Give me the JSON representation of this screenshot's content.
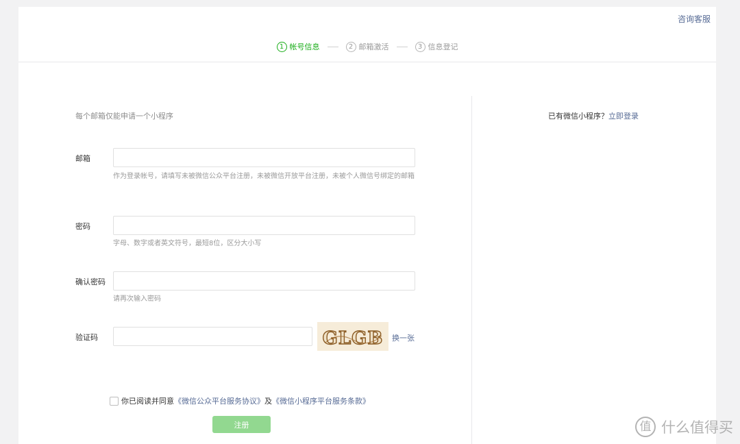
{
  "header": {
    "help_link": "咨询客服",
    "steps": [
      {
        "num": "1",
        "label": "帐号信息"
      },
      {
        "num": "2",
        "label": "邮箱激活"
      },
      {
        "num": "3",
        "label": "信息登记"
      }
    ]
  },
  "form": {
    "tip": "每个邮箱仅能申请一个小程序",
    "email": {
      "label": "邮箱",
      "value": "",
      "hint": "作为登录帐号，请填写未被微信公众平台注册，未被微信开放平台注册，未被个人微信号绑定的邮箱"
    },
    "password": {
      "label": "密码",
      "value": "",
      "hint": "字母、数字或者英文符号，最短8位，区分大小写"
    },
    "confirm_password": {
      "label": "确认密码",
      "value": "",
      "hint": "请再次输入密码"
    },
    "captcha": {
      "label": "验证码",
      "value": "",
      "image_text": "GLGB",
      "swap_link": "换一张"
    },
    "agreement": {
      "prefix": "你已阅读并同意",
      "link1": "《微信公众平台服务协议》",
      "and": "及",
      "link2": "《微信小程序平台服务条款》",
      "checked": false
    },
    "register_button": "注册"
  },
  "side": {
    "have_account": "已有微信小程序？",
    "login_link": "立即登录"
  },
  "watermark": {
    "logo": "值",
    "text": "什么值得买"
  },
  "colors": {
    "accent_green": "#1aad19",
    "button_disabled_green": "#92d890",
    "link_blue": "#576b95"
  }
}
